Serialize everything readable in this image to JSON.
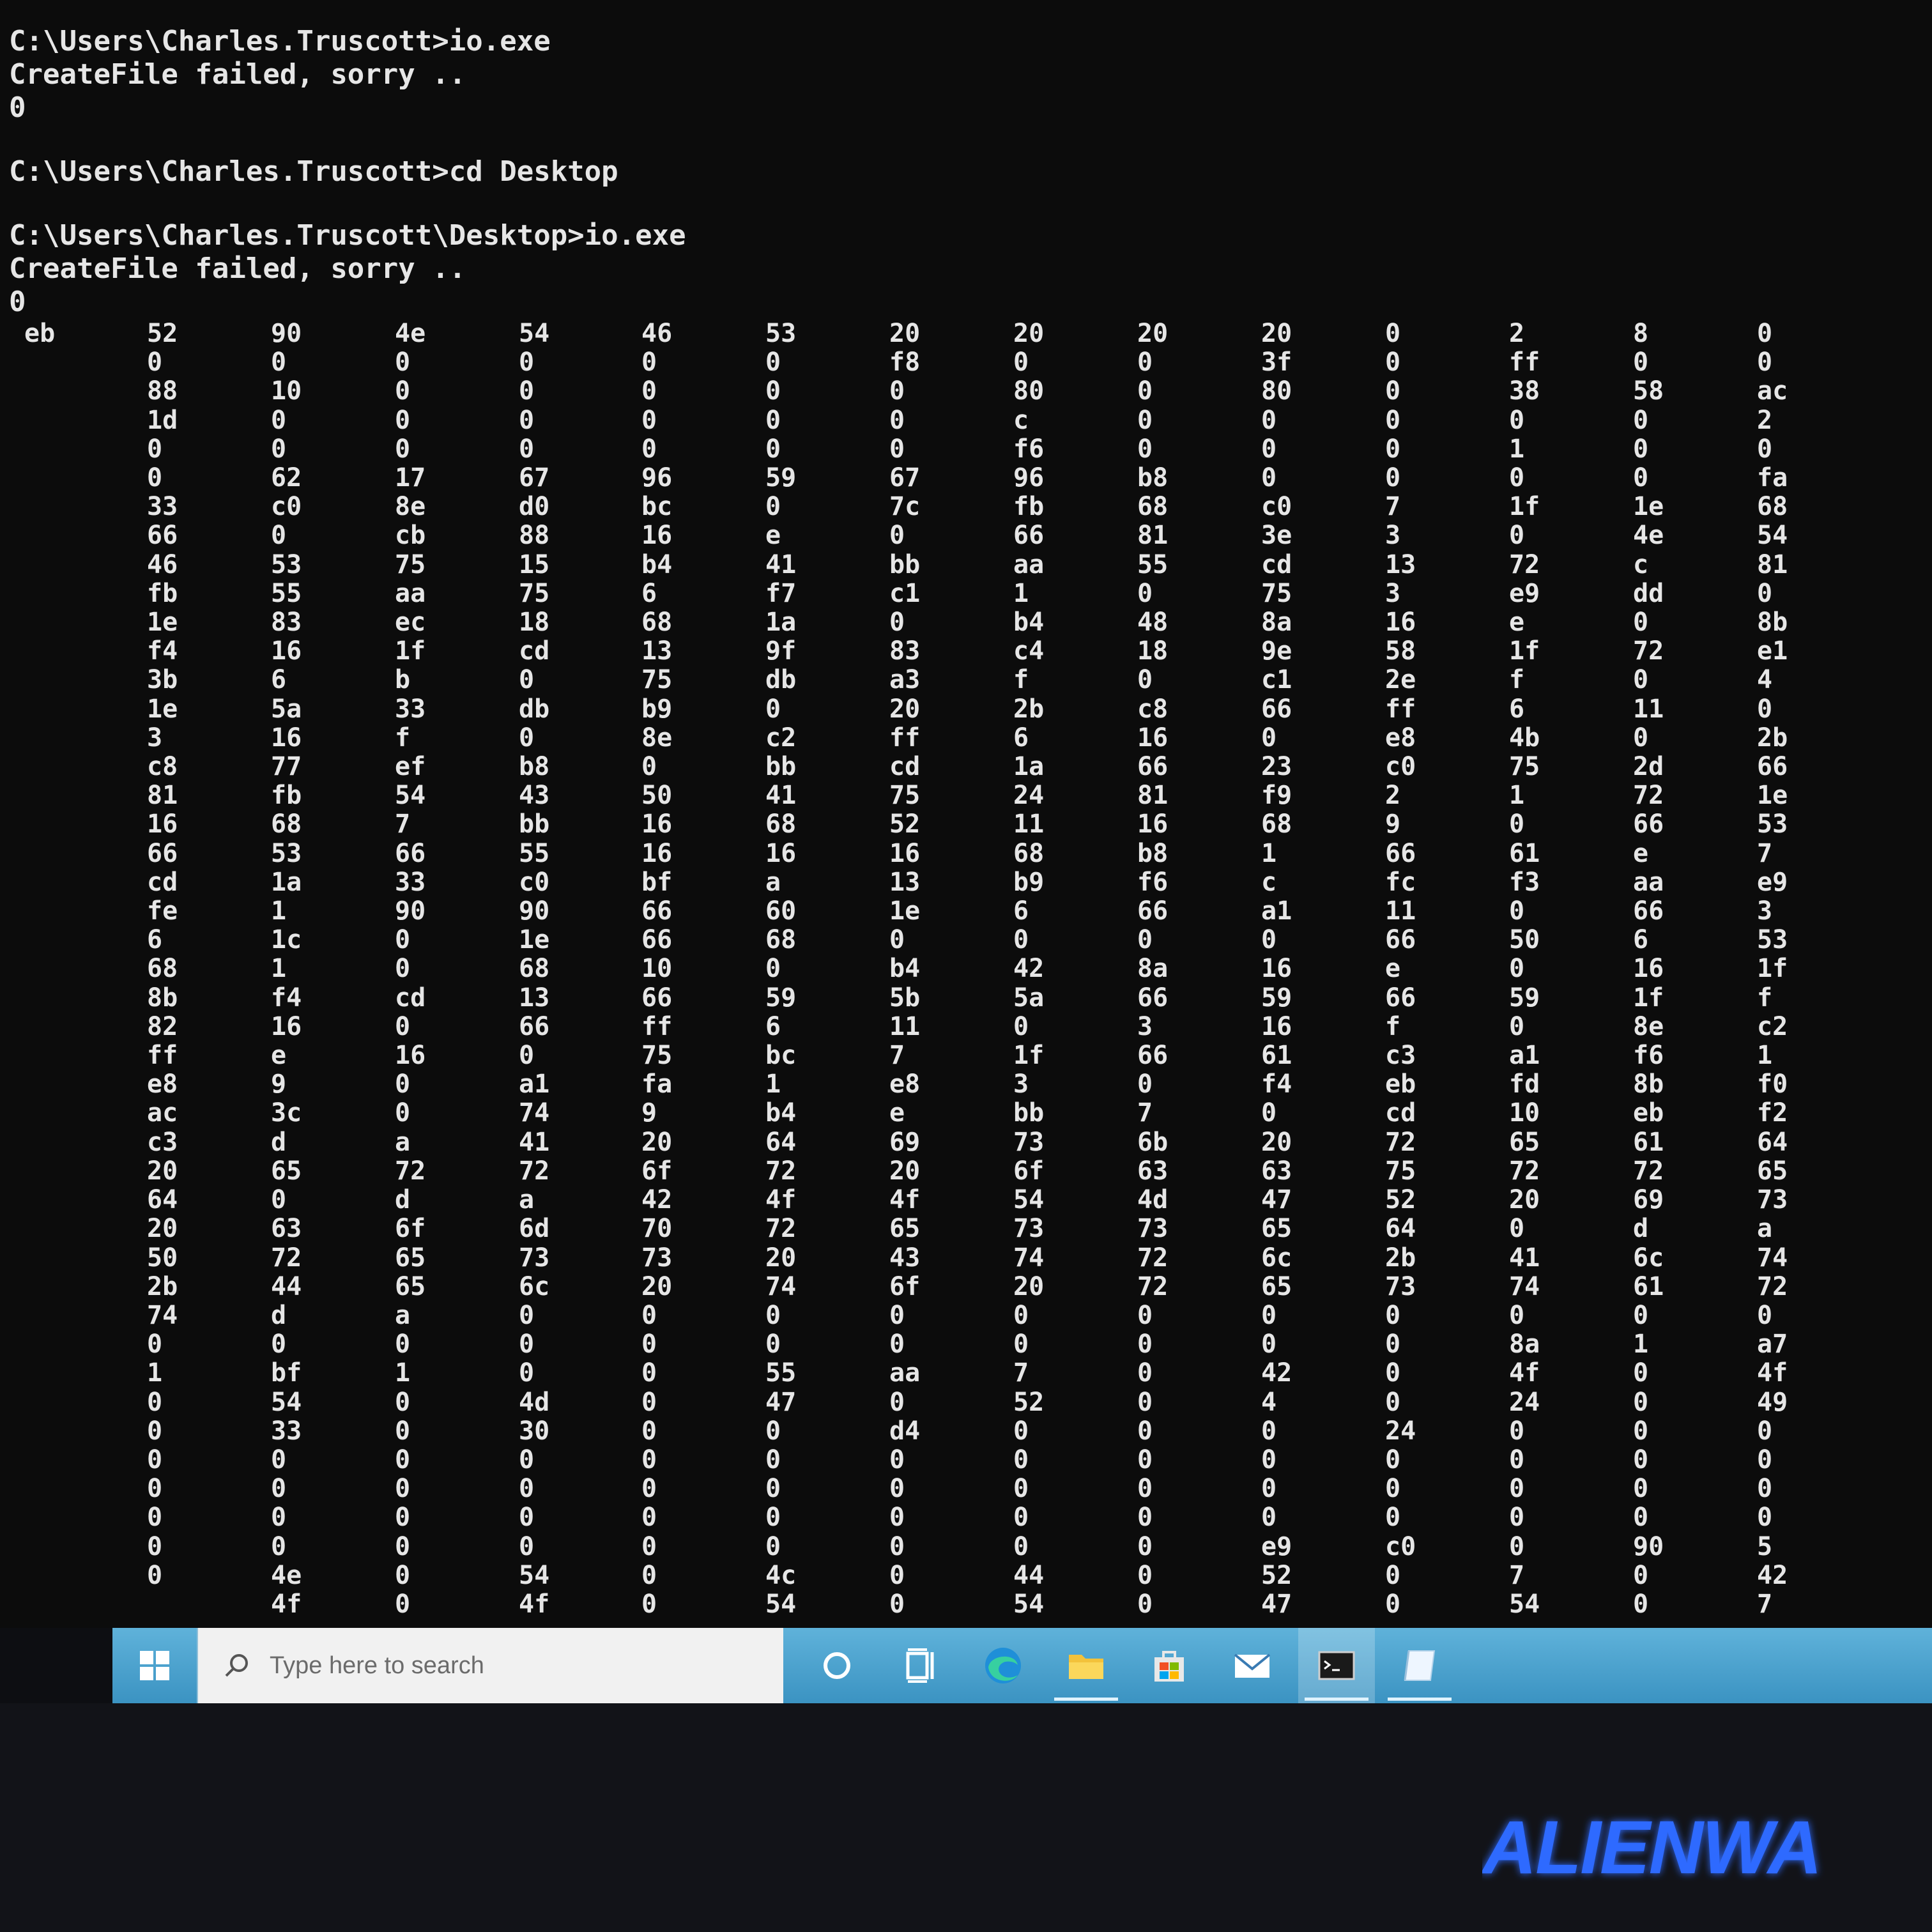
{
  "console": {
    "lines": [
      "C:\\Users\\Charles.Truscott>io.exe",
      "CreateFile failed, sorry ..",
      "0",
      "C:\\Users\\Charles.Truscott>cd Desktop",
      "C:\\Users\\Charles.Truscott\\Desktop>io.exe",
      "CreateFile failed, sorry ..",
      "0"
    ],
    "hex_columns": [
      [
        "eb"
      ],
      [
        "52",
        "0",
        "88",
        "1d",
        "0",
        "0",
        "33",
        "66",
        "46",
        "fb",
        "1e",
        "f4",
        "3b",
        "1e",
        "3",
        "c8",
        "81",
        "16",
        "66",
        "cd",
        "fe",
        "6",
        "68",
        "8b",
        "82",
        "ff",
        "e8",
        "ac",
        "c3",
        "20",
        "64",
        "20",
        "50",
        "2b",
        "74",
        "0",
        "1",
        "0",
        "0",
        "0",
        "0",
        "0",
        "0",
        "0"
      ],
      [
        "90",
        "0",
        "10",
        "0",
        "0",
        "62",
        "c0",
        "0",
        "53",
        "55",
        "83",
        "16",
        "6",
        "5a",
        "16",
        "77",
        "fb",
        "68",
        "53",
        "1a",
        "1",
        "1c",
        "1",
        "f4",
        "16",
        "e",
        "9",
        "3c",
        "d",
        "65",
        "0",
        "63",
        "72",
        "44",
        "d",
        "0",
        "bf",
        "54",
        "33",
        "0",
        "0",
        "0",
        "0",
        "4e",
        "4f"
      ],
      [
        "4e",
        "0",
        "0",
        "0",
        "0",
        "17",
        "8e",
        "cb",
        "75",
        "aa",
        "ec",
        "1f",
        "b",
        "33",
        "f",
        "ef",
        "54",
        "7",
        "66",
        "33",
        "90",
        "0",
        "0",
        "cd",
        "0",
        "16",
        "0",
        "0",
        "a",
        "72",
        "d",
        "6f",
        "65",
        "65",
        "a",
        "0",
        "1",
        "0",
        "0",
        "0",
        "0",
        "0",
        "0",
        "0",
        "0"
      ],
      [
        "54",
        "0",
        "0",
        "0",
        "0",
        "67",
        "d0",
        "88",
        "15",
        "75",
        "18",
        "cd",
        "0",
        "db",
        "0",
        "b8",
        "43",
        "bb",
        "55",
        "c0",
        "90",
        "1e",
        "68",
        "13",
        "66",
        "0",
        "a1",
        "74",
        "41",
        "72",
        "a",
        "6d",
        "73",
        "6c",
        "0",
        "0",
        "0",
        "4d",
        "30",
        "0",
        "0",
        "0",
        "0",
        "54",
        "4f"
      ],
      [
        "46",
        "0",
        "0",
        "0",
        "0",
        "96",
        "bc",
        "16",
        "b4",
        "6",
        "68",
        "13",
        "75",
        "b9",
        "8e",
        "0",
        "50",
        "16",
        "16",
        "bf",
        "66",
        "66",
        "10",
        "66",
        "ff",
        "75",
        "fa",
        "9",
        "20",
        "6f",
        "42",
        "70",
        "73",
        "20",
        "0",
        "0",
        "0",
        "0",
        "0",
        "0",
        "0",
        "0",
        "0",
        "0",
        "0"
      ],
      [
        "53",
        "0",
        "0",
        "0",
        "0",
        "59",
        "0",
        "e",
        "41",
        "f7",
        "1a",
        "9f",
        "db",
        "0",
        "c2",
        "bb",
        "41",
        "68",
        "16",
        "a",
        "60",
        "68",
        "0",
        "59",
        "6",
        "bc",
        "1",
        "b4",
        "64",
        "72",
        "4f",
        "72",
        "20",
        "74",
        "0",
        "0",
        "55",
        "47",
        "0",
        "0",
        "0",
        "0",
        "0",
        "4c",
        "54"
      ],
      [
        "20",
        "f8",
        "0",
        "0",
        "0",
        "67",
        "7c",
        "0",
        "bb",
        "c1",
        "0",
        "83",
        "a3",
        "20",
        "ff",
        "cd",
        "75",
        "52",
        "16",
        "13",
        "1e",
        "0",
        "b4",
        "5b",
        "11",
        "7",
        "e8",
        "e",
        "69",
        "20",
        "4f",
        "65",
        "43",
        "6f",
        "0",
        "0",
        "aa",
        "0",
        "d4",
        "0",
        "0",
        "0",
        "0",
        "0",
        "0"
      ],
      [
        "20",
        "0",
        "80",
        "c",
        "f6",
        "96",
        "fb",
        "66",
        "aa",
        "1",
        "b4",
        "c4",
        "f",
        "2b",
        "6",
        "1a",
        "24",
        "11",
        "68",
        "b9",
        "6",
        "0",
        "42",
        "5a",
        "0",
        "1f",
        "3",
        "bb",
        "73",
        "6f",
        "54",
        "73",
        "74",
        "20",
        "0",
        "0",
        "7",
        "52",
        "0",
        "0",
        "0",
        "0",
        "0",
        "44",
        "54"
      ],
      [
        "20",
        "0",
        "0",
        "0",
        "0",
        "b8",
        "68",
        "81",
        "55",
        "0",
        "48",
        "18",
        "0",
        "c8",
        "16",
        "66",
        "81",
        "16",
        "b8",
        "f6",
        "66",
        "0",
        "8a",
        "66",
        "3",
        "66",
        "0",
        "7",
        "6b",
        "63",
        "4d",
        "73",
        "72",
        "72",
        "0",
        "0",
        "0",
        "0",
        "0",
        "0",
        "0",
        "0",
        "0",
        "0",
        "0"
      ],
      [
        "20",
        "3f",
        "80",
        "0",
        "0",
        "0",
        "c0",
        "3e",
        "cd",
        "75",
        "8a",
        "9e",
        "c1",
        "66",
        "0",
        "23",
        "f9",
        "68",
        "1",
        "c",
        "a1",
        "0",
        "16",
        "59",
        "16",
        "61",
        "f4",
        "0",
        "20",
        "63",
        "47",
        "65",
        "6c",
        "65",
        "0",
        "0",
        "42",
        "4",
        "0",
        "0",
        "0",
        "0",
        "e9",
        "52",
        "47"
      ],
      [
        "0",
        "0",
        "0",
        "0",
        "0",
        "0",
        "7",
        "3",
        "13",
        "3",
        "16",
        "58",
        "2e",
        "ff",
        "e8",
        "c0",
        "2",
        "9",
        "66",
        "fc",
        "11",
        "66",
        "e",
        "66",
        "f",
        "c3",
        "eb",
        "cd",
        "72",
        "75",
        "52",
        "64",
        "2b",
        "73",
        "0",
        "0",
        "0",
        "0",
        "24",
        "0",
        "0",
        "0",
        "c0",
        "0",
        "0"
      ],
      [
        "2",
        "ff",
        "38",
        "0",
        "1",
        "0",
        "1f",
        "0",
        "72",
        "e9",
        "e",
        "1f",
        "f",
        "6",
        "4b",
        "75",
        "1",
        "0",
        "61",
        "f3",
        "0",
        "50",
        "0",
        "59",
        "0",
        "a1",
        "fd",
        "10",
        "65",
        "72",
        "20",
        "0",
        "41",
        "74",
        "0",
        "8a",
        "4f",
        "24",
        "0",
        "0",
        "0",
        "0",
        "0",
        "7",
        "54"
      ],
      [
        "8",
        "0",
        "58",
        "0",
        "0",
        "0",
        "1e",
        "4e",
        "c",
        "dd",
        "0",
        "72",
        "0",
        "11",
        "0",
        "2d",
        "72",
        "66",
        "e",
        "aa",
        "66",
        "6",
        "16",
        "1f",
        "8e",
        "f6",
        "8b",
        "eb",
        "61",
        "72",
        "69",
        "d",
        "6c",
        "61",
        "0",
        "1",
        "0",
        "0",
        "0",
        "0",
        "0",
        "0",
        "90",
        "0",
        "0"
      ],
      [
        "0",
        "0",
        "ac",
        "2",
        "0",
        "fa",
        "68",
        "54",
        "81",
        "0",
        "8b",
        "e1",
        "4",
        "0",
        "2b",
        "66",
        "1e",
        "53",
        "7",
        "e9",
        "3",
        "53",
        "1f",
        "f",
        "c2",
        "1",
        "f0",
        "f2",
        "64",
        "65",
        "73",
        "a",
        "74",
        "72",
        "0",
        "a7",
        "4f",
        "49",
        "0",
        "0",
        "0",
        "0",
        "5",
        "42",
        "7"
      ]
    ]
  },
  "taskbar": {
    "search_placeholder": "Type here to search",
    "items": [
      "cortana",
      "task-view",
      "edge",
      "file-explorer",
      "store",
      "mail",
      "command-prompt",
      "notes"
    ]
  },
  "brand": {
    "logo_text": "ALIENWA",
    "color": "#2f6bff"
  },
  "colors": {
    "console_bg": "#0c0c0c",
    "console_text": "#e6e6e6",
    "taskbar": "#4aa3d0"
  }
}
